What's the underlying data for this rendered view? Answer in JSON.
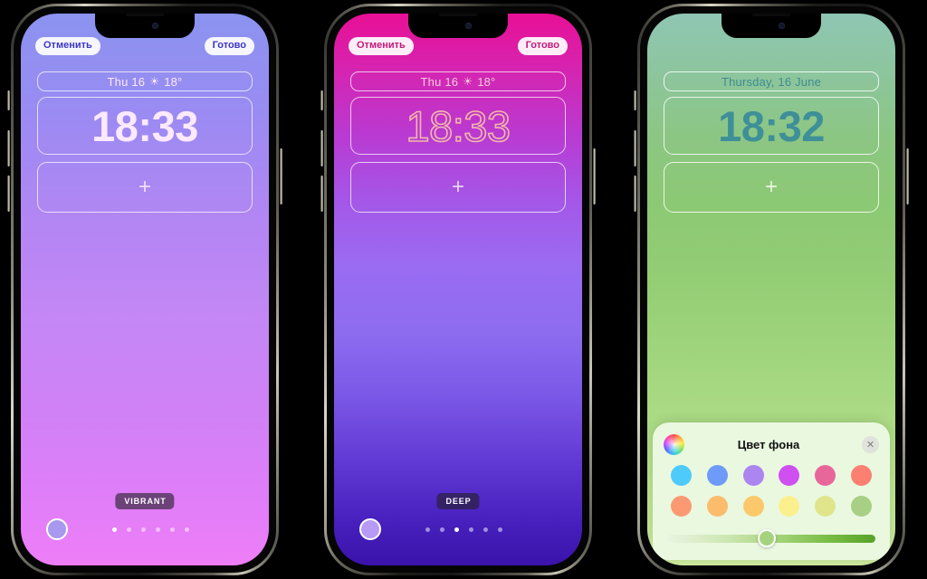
{
  "phones": [
    {
      "id": "phone-vibrant",
      "cancel_label": "Отменить",
      "done_label": "Готово",
      "date_text": "Thu 16",
      "weather_icon": "☀",
      "temperature": "18°",
      "clock": "18:33",
      "add_widget_icon": "+",
      "style_tag": "VIBRANT",
      "swatch_color": "#a898ef",
      "dots_count": 6,
      "active_dot": 0,
      "gradient_top": "#8b93f0",
      "gradient_bottom": "#ee7ef8"
    },
    {
      "id": "phone-deep",
      "cancel_label": "Отменить",
      "done_label": "Готово",
      "date_text": "Thu 16",
      "weather_icon": "☀",
      "temperature": "18°",
      "clock": "18:33",
      "add_widget_icon": "+",
      "style_tag": "DEEP",
      "swatch_color": "#b79af5",
      "dots_count": 6,
      "active_dot": 2,
      "gradient_top": "#e80f95",
      "gradient_bottom": "#3a13ab"
    },
    {
      "id": "phone-green",
      "date_text": "Thursday, 16 June",
      "clock": "18:32",
      "add_widget_icon": "+",
      "gradient_top": "#8fc6b4",
      "gradient_bottom": "#cdea9e",
      "clock_color": "#3e8f98"
    }
  ],
  "picker": {
    "title": "Цвет фона",
    "wheel_icon": "color-wheel",
    "close_icon": "✕",
    "swatches": [
      "#4ecbfa",
      "#6e9bf7",
      "#ab85f0",
      "#cf4ff0",
      "#e8679a",
      "#fb8071",
      "#fb9a72",
      "#fbbc6b",
      "#fbc96b",
      "#fbf08e",
      "#e0e58c",
      "#a8d085"
    ],
    "slider_value": 48,
    "slider_thumb_color": "#a5d37d",
    "slider_from": "#eaf4e2",
    "slider_to": "#57a327"
  }
}
